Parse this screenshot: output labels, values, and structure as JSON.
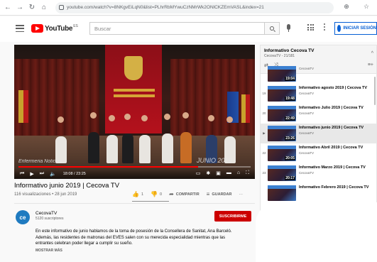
{
  "browser": {
    "url": "youtube.com/watch?v=8NKgvEiLqN0&list=PLhrRbMYwuCzNMrWk2ONlCKZEmVASL&index=21",
    "back_icon": "back-arrow-icon",
    "forward_icon": "forward-arrow-icon",
    "reload_icon": "reload-icon",
    "home_icon": "home-icon"
  },
  "header": {
    "logo_text": "YouTube",
    "logo_sup": "ES",
    "search_placeholder": "Buscar",
    "signin_label": "INICIAR SESIÓN"
  },
  "player": {
    "overlay_title": "Enfermeria Noticias",
    "overlay_date": "JUNIO 2019",
    "time": "18:08 / 23:25",
    "progress": 0.774
  },
  "video": {
    "title": "Informativo junio 2019 | Cecova TV",
    "meta": "116 visualizaciones • 28 jun 2019",
    "likes": "1",
    "dislikes": "0",
    "share_label": "COMPARTIR",
    "save_label": "GUARDAR"
  },
  "channel": {
    "avatar": "ce",
    "name": "CecovaTV",
    "subs": "5120 suscriptores",
    "subscribe_label": "SUSCRIBIRME",
    "description": "En este informativo de junio hablamos de la toma de posesión de la Consellera de Sanitat, Ana Barceló. Además, las residentes de matronas del EVES salen con su merecida especialidad mientras que las entrantes celebran poder llegar a cumplir su sueño.",
    "show_more": "MOSTRAR MÁS"
  },
  "playlist": {
    "title": "Informativo Cecova TV",
    "subtitle": "CecovaTV - 21/181",
    "items": [
      {
        "index": "",
        "title": "",
        "channel": "CecovaTV",
        "duration": "19:04",
        "active": false
      },
      {
        "index": "19",
        "title": "Informativo agosto 2019 | Cecova TV",
        "channel": "CecovaTV",
        "duration": "19:48",
        "active": false
      },
      {
        "index": "20",
        "title": "Informativo Julio 2019 | Cecova TV",
        "channel": "CecovaTV",
        "duration": "22:49",
        "active": false
      },
      {
        "index": "▶",
        "title": "Informativo junio 2019 | Cecova TV",
        "channel": "CecovaTV",
        "duration": "23:26",
        "active": true
      },
      {
        "index": "22",
        "title": "Informativo Abril 2019 | Cecova TV",
        "channel": "CecovaTV",
        "duration": "20:05",
        "active": false
      },
      {
        "index": "23",
        "title": "Informativo Marzo 2019 | Cecova TV",
        "channel": "CecovaTV",
        "duration": "20:17",
        "active": false
      },
      {
        "index": "",
        "title": "Informativo Febrero 2019 | Cecova TV",
        "channel": "",
        "duration": "",
        "active": false
      }
    ]
  }
}
